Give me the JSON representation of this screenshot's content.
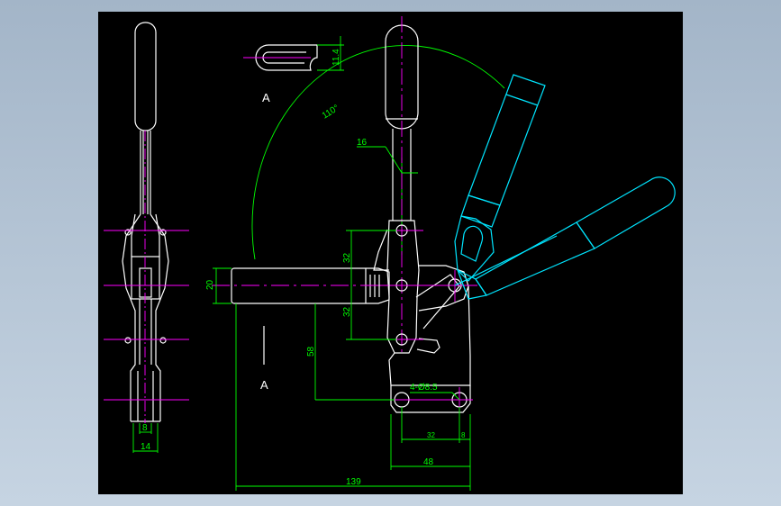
{
  "drawing": {
    "view_label_top": "A",
    "view_label_side": "A",
    "dims": {
      "slot_width": "11.4",
      "arc_angle": "110°",
      "rod_diameter": "16",
      "bar_height": "20",
      "upper_pitch": "32",
      "lower_pitch": "32",
      "lever_offset": "58",
      "holes": "4-Ø8.5",
      "hole_pitch": "32",
      "hole_edge": "8",
      "base_width": "48",
      "overall_length": "139",
      "side_inner": "8",
      "side_outer": "14"
    }
  },
  "colors": {
    "background": "#000000",
    "outline": "#ffffff",
    "dimension": "#00ff00",
    "centerline": "#ff00ff",
    "alt_position": "#00e5ff"
  }
}
